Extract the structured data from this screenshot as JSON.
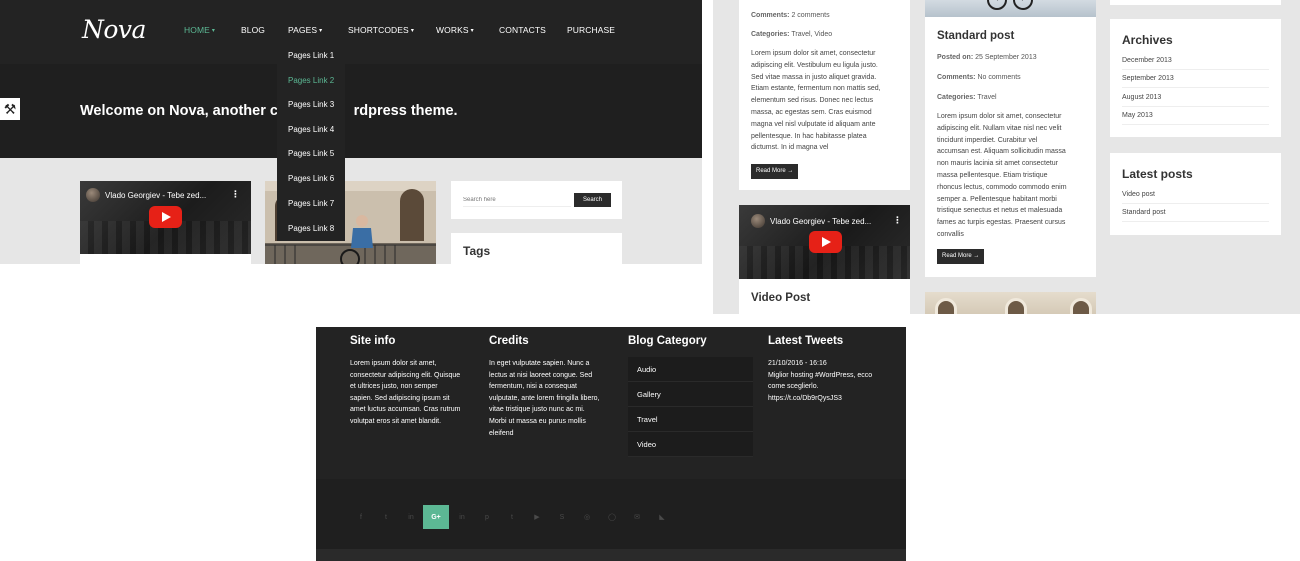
{
  "header": {
    "logo": "Nova",
    "nav": [
      {
        "label": "HOME",
        "caret": "▾",
        "active": true
      },
      {
        "label": "BLOG",
        "caret": "",
        "active": false
      },
      {
        "label": "PAGES",
        "caret": "▾",
        "active": false
      },
      {
        "label": "SHORTCODES",
        "caret": "▾",
        "active": false
      },
      {
        "label": "WORKS",
        "caret": "▾",
        "active": false
      },
      {
        "label": "CONTACTS",
        "caret": "",
        "active": false
      },
      {
        "label": "PURCHASE",
        "caret": "",
        "active": false
      }
    ],
    "dropdown": [
      "Pages Link 1",
      "Pages Link 2",
      "Pages Link 3",
      "Pages Link 4",
      "Pages Link 5",
      "Pages Link 6",
      "Pages Link 7",
      "Pages Link 8"
    ],
    "dropdown_active_index": 1
  },
  "hero": {
    "title_left": "Welcome on Nova, another cr",
    "title_right": "rdpress theme."
  },
  "video": {
    "title": "Vlado Georgiev - Tebe zed...",
    "more": "⋮"
  },
  "search": {
    "placeholder": "Search here",
    "button": "Search"
  },
  "tags_title": "Tags",
  "post_top": {
    "comments_label": "Comments:",
    "comments_value": "2 comments",
    "categories_label": "Categories:",
    "categories_value": "Travel, Video",
    "excerpt": [
      "Lorem ipsum dolor sit amet, consectetur",
      "adipiscing elit. Vestibulum eu ligula justo.",
      "Sed vitae massa in justo aliquet gravida.",
      "Etiam estante, fermentum non mattis sed,",
      "elementum sed risus. Donec nec lectus",
      "massa, ac egestas sem. Cras euismod",
      "magna vel nisl vulputate id aliquam ante",
      "pellentesque. In hac habitasse platea",
      "dictumst. In id magna vel"
    ],
    "read_more": "Read More →"
  },
  "video_post_title": "Video Post",
  "standard_post": {
    "title": "Standard post",
    "posted_label": "Posted on:",
    "posted_value": "25 September 2013",
    "comments_label": "Comments:",
    "comments_value": "No comments",
    "categories_label": "Categories:",
    "categories_value": "Travel",
    "excerpt": [
      "Lorem ipsum dolor sit amet, consectetur",
      "adipiscing elit. Nullam vitae nisl nec velit",
      "tincidunt imperdiet. Curabitur vel",
      "accumsan est. Aliquam sollicitudin massa",
      "non mauris lacinia sit amet consectetur",
      "massa pellentesque. Etiam tristique",
      "rhoncus lectus, commodo commodo enim",
      "semper a. Pellentesque habitant morbi",
      "tristique senectus et netus et malesuada",
      "fames ac turpis egestas. Praesent cursus",
      "convallis"
    ],
    "read_more": "Read More →"
  },
  "archives": {
    "title": "Archives",
    "items": [
      "December 2013",
      "September 2013",
      "August 2013",
      "May 2013"
    ]
  },
  "latest_posts": {
    "title": "Latest posts",
    "items": [
      "Video post",
      "Standard post"
    ]
  },
  "footer": {
    "site_info": {
      "title": "Site info",
      "lines": [
        "Lorem ipsum dolor sit amet,",
        "consectetur adipiscing elit. Quisque",
        "et ultrices justo, non semper",
        "sapien. Sed adipiscing ipsum sit",
        "amet luctus accumsan. Cras rutrum",
        "volutpat eros sit amet blandit."
      ]
    },
    "credits": {
      "title": "Credits",
      "lines": [
        "In eget vulputate sapien. Nunc a",
        "lectus at nisi laoreet congue. Sed",
        "fermentum, nisi a consequat",
        "vulputate, ante lorem fringilla libero,",
        "vitae tristique justo nunc ac mi.",
        "Morbi ut massa eu purus mollis",
        "eleifend"
      ]
    },
    "blog_category": {
      "title": "Blog Category",
      "items": [
        "Audio",
        "Gallery",
        "Travel",
        "Video"
      ]
    },
    "latest_tweets": {
      "title": "Latest Tweets",
      "lines": [
        "21/10/2016 - 16:16",
        "Miglior hosting #WordPress, ecco",
        "come sceglierlo.",
        "https://t.co/Db9rQysJS3"
      ]
    },
    "social": [
      {
        "name": "facebook-icon",
        "glyph": "f"
      },
      {
        "name": "twitter-icon",
        "glyph": "t"
      },
      {
        "name": "linkedin-icon",
        "glyph": "in"
      },
      {
        "name": "google-plus-icon",
        "glyph": "G+"
      },
      {
        "name": "linkedin-alt-icon",
        "glyph": "in"
      },
      {
        "name": "pinterest-icon",
        "glyph": "p"
      },
      {
        "name": "tumblr-icon",
        "glyph": "t"
      },
      {
        "name": "youtube-icon",
        "glyph": "▶"
      },
      {
        "name": "skype-icon",
        "glyph": "S"
      },
      {
        "name": "dribbble-icon",
        "glyph": "◎"
      },
      {
        "name": "github-icon",
        "glyph": "◯"
      },
      {
        "name": "email-icon",
        "glyph": "✉"
      },
      {
        "name": "rss-icon",
        "glyph": "◣"
      }
    ],
    "social_active_index": 3
  },
  "colors": {
    "accent": "#5cb894",
    "dark": "#232323",
    "light_bg": "#e6e6e6"
  }
}
